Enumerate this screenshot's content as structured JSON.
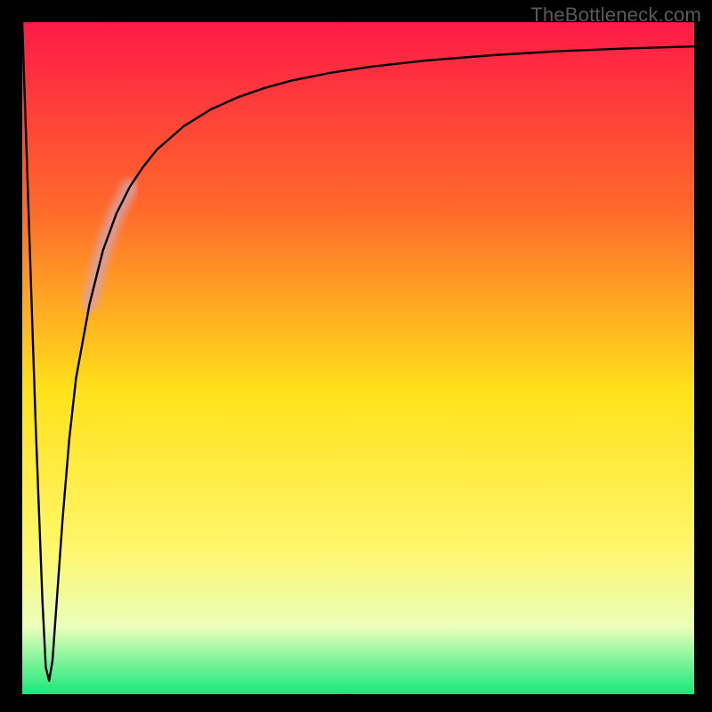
{
  "watermark": "TheBottleneck.com",
  "chart_data": {
    "type": "line",
    "title": "",
    "xlabel": "",
    "ylabel": "",
    "xlim": [
      0,
      100
    ],
    "ylim": [
      0,
      100
    ],
    "grid": false,
    "legend": false,
    "series": [
      {
        "name": "bottleneck-curve",
        "x": [
          0,
          1,
          2,
          3,
          3.5,
          4,
          4.5,
          5,
          6,
          7,
          8,
          10,
          12,
          14,
          16,
          18,
          20,
          24,
          28,
          32,
          36,
          40,
          46,
          52,
          60,
          70,
          80,
          90,
          100
        ],
        "y": [
          100,
          70,
          40,
          14,
          4,
          2,
          5,
          12,
          26,
          38,
          47,
          58,
          66,
          71.5,
          75.5,
          78.5,
          81,
          84.5,
          87,
          88.8,
          90.2,
          91.3,
          92.5,
          93.4,
          94.3,
          95.1,
          95.7,
          96.1,
          96.4
        ]
      }
    ],
    "highlight_segment": {
      "series": "bottleneck-curve",
      "from_index": 11,
      "to_index": 14,
      "note": "fuzzy light-red highlighted band along the curve"
    },
    "background_gradient": {
      "top": "#ff1a47",
      "mid_upper": "#ff8a1f",
      "mid": "#ffe21a",
      "mid_lower": "#f7ffa8",
      "bottom": "#17e87a"
    }
  },
  "colors": {
    "frame": "#000000",
    "curve": "#000000",
    "highlight": "rgba(216,160,160,0.85)",
    "watermark": "#5a5a5a"
  }
}
